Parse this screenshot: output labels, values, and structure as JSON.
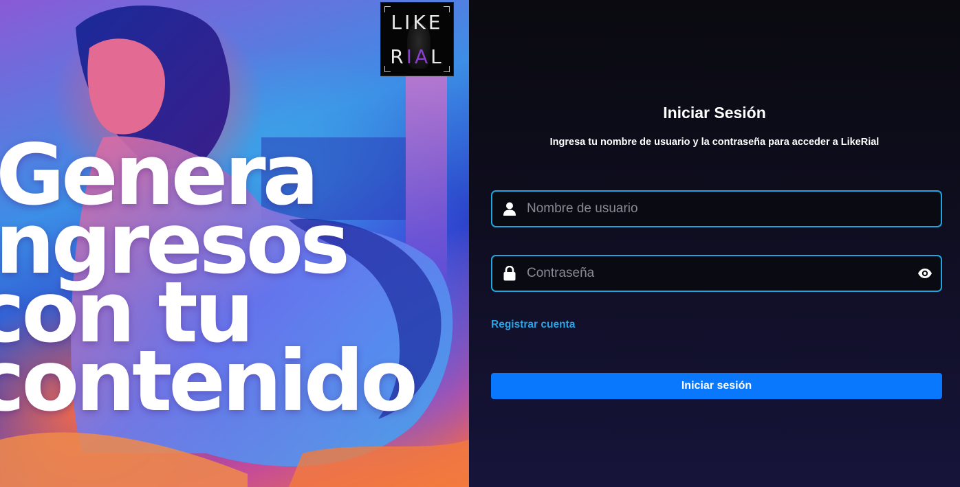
{
  "hero": {
    "headline": [
      "Genera",
      "ingresos",
      "con tu",
      "contenido"
    ],
    "logo": {
      "line1": "LIKE",
      "line2_a": "R",
      "line2_accent": "IA",
      "line2_b": "L"
    }
  },
  "login": {
    "title": "Iniciar Sesión",
    "subtitle": "Ingresa tu nombre de usuario y la contraseña para acceder a LikeRial",
    "username_placeholder": "Nombre de usuario",
    "password_placeholder": "Contraseña",
    "register_label": "Registrar cuenta",
    "submit_label": "Iniciar sesión"
  },
  "icons": {
    "username": "user-icon",
    "password": "lock-icon",
    "toggle": "eye-icon"
  },
  "colors": {
    "accent_border": "#1ea6e0",
    "button": "#0a78fc",
    "link": "#2aa3e6",
    "logo_accent": "#8a3fd0"
  }
}
